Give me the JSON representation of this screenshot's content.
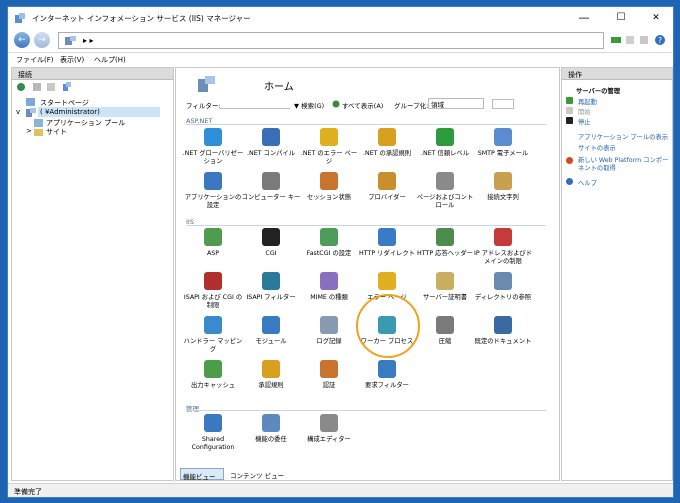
{
  "window": {
    "title": "インターネット インフォメーション サービス (IIS) マネージャー",
    "minimize": "—",
    "maximize": "☐",
    "close": "✕"
  },
  "address": {
    "path": "▸ ▸"
  },
  "menu": {
    "file": "ファイル(F)",
    "view": "表示(V)",
    "help": "ヘルプ(H)"
  },
  "connections": {
    "header": "接続",
    "tree": {
      "start_page": "スタートページ",
      "server": "(        ¥Administrator)",
      "app_pools": "アプリケーション プール",
      "sites": "サイト"
    }
  },
  "home": {
    "title": "ホーム",
    "filter_label": "フィルター:",
    "search_label": "▼ 検索(G)",
    "show_all_label": "すべて表示(A)",
    "group_label": "グループ化:",
    "group_value": "領域",
    "sections": {
      "aspnet": "ASP.NET",
      "iis": "IIS",
      "management": "管理"
    },
    "aspnet_features": [
      {
        "label": ".NET グローバリゼーション",
        "icon": "globe-icon",
        "color": "#2f8fd8"
      },
      {
        "label": ".NET コンパイル",
        "icon": "download-icon",
        "color": "#3a6fb5"
      },
      {
        "label": ".NET のエラー ページ",
        "icon": "warning-page-icon",
        "color": "#e0b020"
      },
      {
        "label": ".NET の承認規則",
        "icon": "lock-icon",
        "color": "#d8a020"
      },
      {
        "label": ".NET 信頼レベル",
        "icon": "check-shield-icon",
        "color": "#2e9a3e"
      },
      {
        "label": "SMTP 電子メール",
        "icon": "mail-icon",
        "color": "#5a8ccf"
      },
      {
        "label": "アプリケーションの設定",
        "icon": "settings-list-icon",
        "color": "#3b78c0"
      },
      {
        "label": "コンピューター キー",
        "icon": "key-icon",
        "color": "#7a7a7a"
      },
      {
        "label": "セッション状態",
        "icon": "users-icon",
        "color": "#c8742c"
      },
      {
        "label": "プロバイダー",
        "icon": "users-group-icon",
        "color": "#c8902c"
      },
      {
        "label": "ページおよびコントロール",
        "icon": "page-control-icon",
        "color": "#8a8a8a"
      },
      {
        "label": "接続文字列",
        "icon": "connection-string-icon",
        "color": "#c9a050"
      }
    ],
    "iis_features": [
      {
        "label": "ASP",
        "icon": "asp-icon",
        "color": "#4f9c4f"
      },
      {
        "label": "CGI",
        "icon": "cgi-icon",
        "color": "#222222"
      },
      {
        "label": "FastCGI の設定",
        "icon": "fastcgi-icon",
        "color": "#4d9c5b"
      },
      {
        "label": "HTTP リダイレクト",
        "icon": "redirect-icon",
        "color": "#3b7ac4"
      },
      {
        "label": "HTTP 応答ヘッダー",
        "icon": "headers-icon",
        "color": "#4c8c4c"
      },
      {
        "label": "IP アドレスおよびドメインの制限",
        "icon": "ip-restrict-icon",
        "color": "#c43b3b"
      },
      {
        "label": "ISAPI および CGI の制限",
        "icon": "isapi-cgi-icon",
        "color": "#b32f2f"
      },
      {
        "label": "ISAPI フィルター",
        "icon": "filter-globe-icon",
        "color": "#2a7a9c"
      },
      {
        "label": "MIME の種類",
        "icon": "mime-icon",
        "color": "#8a6fc0"
      },
      {
        "label": "エラー ページ",
        "icon": "error-page-icon",
        "color": "#e0b020"
      },
      {
        "label": "サーバー証明書",
        "icon": "certificate-icon",
        "color": "#c8b060"
      },
      {
        "label": "ディレクトリの参照",
        "icon": "directory-browse-icon",
        "color": "#6a8ab0"
      },
      {
        "label": "ハンドラー マッピング",
        "icon": "handler-icon",
        "color": "#3a8ad0"
      },
      {
        "label": "モジュール",
        "icon": "module-icon",
        "color": "#3a7ac0"
      },
      {
        "label": "ログ記録",
        "icon": "log-icon",
        "color": "#8a9ab0"
      },
      {
        "label": "ワーカー プロセス",
        "icon": "worker-process-icon",
        "color": "#3a9ab0"
      },
      {
        "label": "圧縮",
        "icon": "compress-icon",
        "color": "#7a7a7a"
      },
      {
        "label": "既定のドキュメント",
        "icon": "default-doc-icon",
        "color": "#3a6aa0"
      },
      {
        "label": "出力キャッシュ",
        "icon": "cache-icon",
        "color": "#4c9c4c"
      },
      {
        "label": "承認規則",
        "icon": "auth-rules-icon",
        "color": "#d8a020"
      },
      {
        "label": "認証",
        "icon": "authentication-icon",
        "color": "#c8742c"
      },
      {
        "label": "要求フィルター",
        "icon": "request-filter-icon",
        "color": "#3a7ac0"
      }
    ],
    "management_features": [
      {
        "label": "Shared Configuration",
        "icon": "shared-config-icon",
        "color": "#3a78c0"
      },
      {
        "label": "機能の委任",
        "icon": "delegation-icon",
        "color": "#5a8ac0"
      },
      {
        "label": "構成エディター",
        "icon": "config-editor-icon",
        "color": "#8a8a8a"
      }
    ],
    "view_tabs": {
      "features": "機能ビュー",
      "content": "コンテンツ ビュー"
    }
  },
  "actions": {
    "header": "操作",
    "group": "サーバーの管理",
    "restart": "再起動",
    "start": "開始",
    "stop": "停止",
    "view_app_pools": "アプリケーション プールの表示",
    "view_sites": "サイトの表示",
    "new_components": "新しい Web Platform コンポーネントの取得",
    "help": "ヘルプ"
  },
  "status": {
    "text": "準備完了"
  },
  "colors": {
    "accent": "#1f62b1",
    "highlight": "#f0a21a",
    "section": "#4e6a8a"
  }
}
